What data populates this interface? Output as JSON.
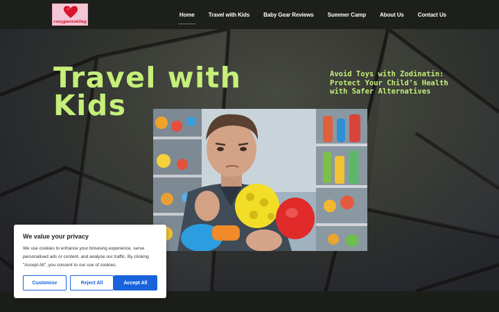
{
  "logo": {
    "text": "cozyparenting",
    "icon": "heart-icon"
  },
  "nav": {
    "items": [
      {
        "label": "Home",
        "active": true
      },
      {
        "label": "Travel with Kids",
        "active": false
      },
      {
        "label": "Baby Gear Reviews",
        "active": false
      },
      {
        "label": "Summer Camp",
        "active": false
      },
      {
        "label": "About Us",
        "active": false
      },
      {
        "label": "Contact Us",
        "active": false
      }
    ]
  },
  "hero": {
    "title": "Travel with Kids",
    "article_title": "Avoid Toys with Zodinatin: Protect Your Child’s Health with Safer Alternatives"
  },
  "cookie_banner": {
    "title": "We value your privacy",
    "text": "We use cookies to enhance your browsing experience, serve personalised ads or content, and analyse our traffic. By clicking \"Accept All\", you consent to our use of cookies.",
    "customise_label": "Customise",
    "reject_label": "Reject All",
    "accept_label": "Accept All"
  },
  "colors": {
    "accent": "#c5ef79",
    "header_bg": "#1d1f1b",
    "button_blue": "#1863dc"
  }
}
